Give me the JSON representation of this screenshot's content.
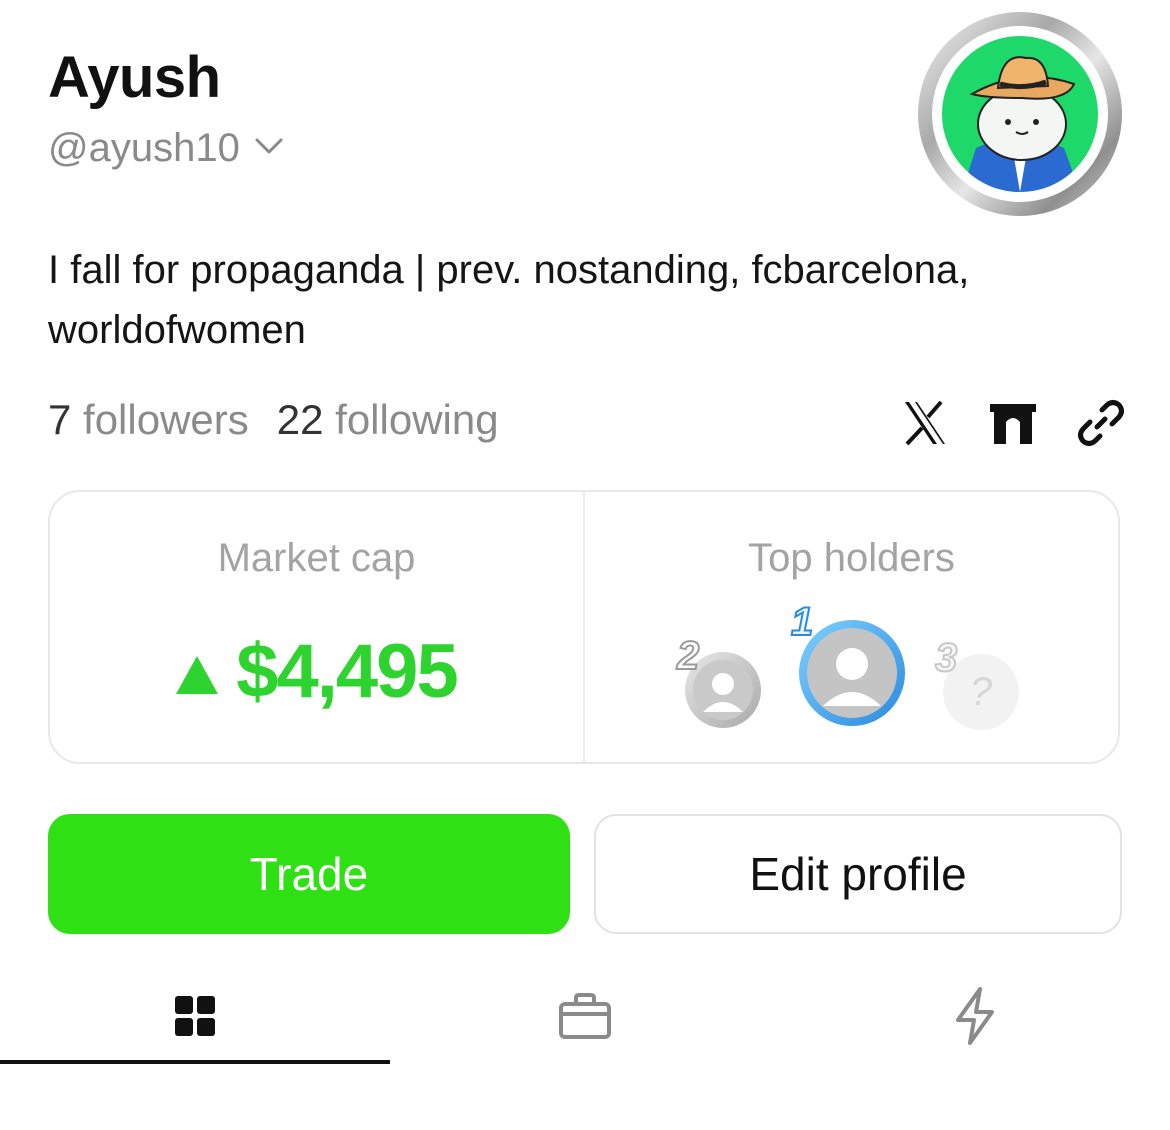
{
  "profile": {
    "name": "Ayush",
    "handle": "@ayush10",
    "bio": "I fall for propaganda | prev. nostanding, fcbarcelona, worldofwomen"
  },
  "stats": {
    "followers_count": "7",
    "followers_label": "followers",
    "following_count": "22",
    "following_label": "following"
  },
  "socials": [
    "x-icon",
    "foundation-icon",
    "link-icon"
  ],
  "card": {
    "market_cap_label": "Market cap",
    "market_cap_value": "$4,495",
    "top_holders_label": "Top holders",
    "holders": [
      {
        "rank": "2"
      },
      {
        "rank": "1"
      },
      {
        "rank": "3",
        "placeholder": "?"
      }
    ]
  },
  "actions": {
    "trade_label": "Trade",
    "edit_label": "Edit profile"
  },
  "tabs": [
    "grid-icon",
    "bag-icon",
    "bolt-icon"
  ],
  "colors": {
    "accent_green": "#2fe014",
    "price_green": "#2fd32f",
    "muted_text": "#8a8a8a"
  }
}
